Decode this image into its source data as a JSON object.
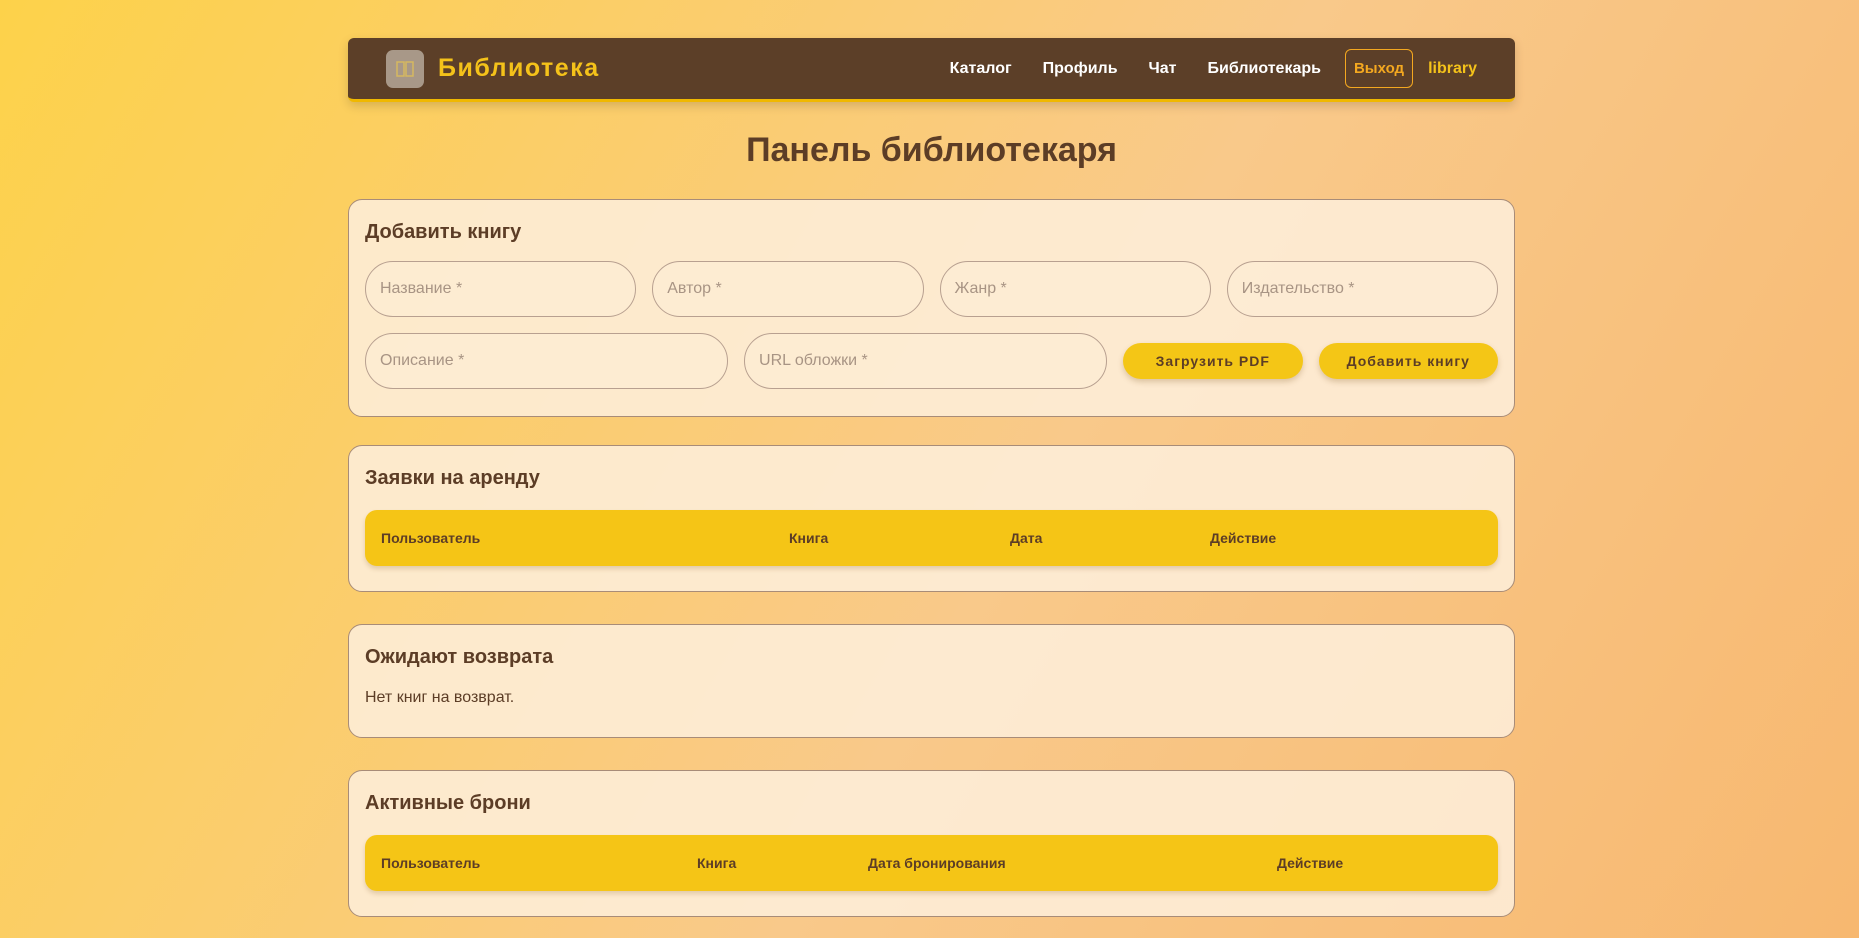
{
  "header": {
    "brand": "Библиотека",
    "logo_icon": "book-icon",
    "nav": [
      "Каталог",
      "Профиль",
      "Чат",
      "Библиотекарь"
    ],
    "logout_label": "Выход",
    "username": "library"
  },
  "page_title": "Панель библиотекаря",
  "add_book": {
    "title": "Добавить книгу",
    "placeholders": {
      "name": "Название *",
      "author": "Автор *",
      "genre": "Жанр *",
      "publisher": "Издательство *",
      "description": "Описание *",
      "cover_url": "URL обложки *"
    },
    "upload_label": "Загрузить PDF",
    "add_label": "Добавить книгу"
  },
  "rent_requests": {
    "title": "Заявки на аренду",
    "columns": [
      "Пользователь",
      "Книга",
      "Дата",
      "Действие"
    ]
  },
  "awaiting_return": {
    "title": "Ожидают возврата",
    "empty_text": "Нет книг на возврат."
  },
  "active_reservations": {
    "title": "Активные брони",
    "columns": [
      "Пользователь",
      "Книга",
      "Дата бронирования",
      "Действие"
    ]
  },
  "colors": {
    "navbar": "#5c3f28",
    "accent": "#f4c616",
    "text": "#5c3d26"
  }
}
